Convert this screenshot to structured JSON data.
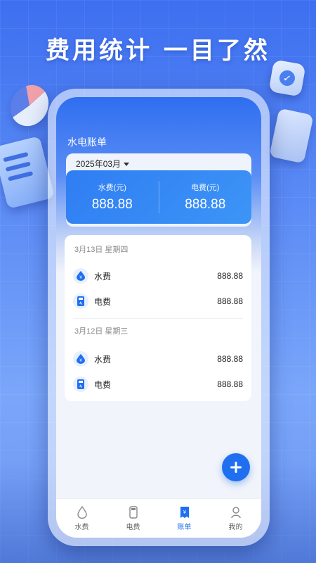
{
  "headline": "费用统计 一目了然",
  "app": {
    "title": "水电账单",
    "month": "2025年03月",
    "summary": {
      "water_label": "水费(元)",
      "water_value": "888.88",
      "electric_label": "电费(元)",
      "electric_value": "888.88"
    },
    "days": [
      {
        "date": "3月13日  星期四",
        "items": [
          {
            "icon": "water-drop-icon",
            "name": "水费",
            "amount": "888.88"
          },
          {
            "icon": "electric-meter-icon",
            "name": "电费",
            "amount": "888.88"
          }
        ]
      },
      {
        "date": "3月12日  星期三",
        "items": [
          {
            "icon": "water-drop-icon",
            "name": "水费",
            "amount": "888.88"
          },
          {
            "icon": "electric-meter-icon",
            "name": "电费",
            "amount": "888.88"
          }
        ]
      }
    ],
    "tabs": [
      {
        "label": "水费",
        "icon": "water-tab-icon",
        "active": false
      },
      {
        "label": "电费",
        "icon": "electric-tab-icon",
        "active": false
      },
      {
        "label": "账单",
        "icon": "bill-tab-icon",
        "active": true
      },
      {
        "label": "我的",
        "icon": "profile-tab-icon",
        "active": false
      }
    ]
  },
  "colors": {
    "accent": "#1f6ff0",
    "summary_gradient_start": "#2f7df3",
    "summary_gradient_end": "#3d95f6"
  }
}
